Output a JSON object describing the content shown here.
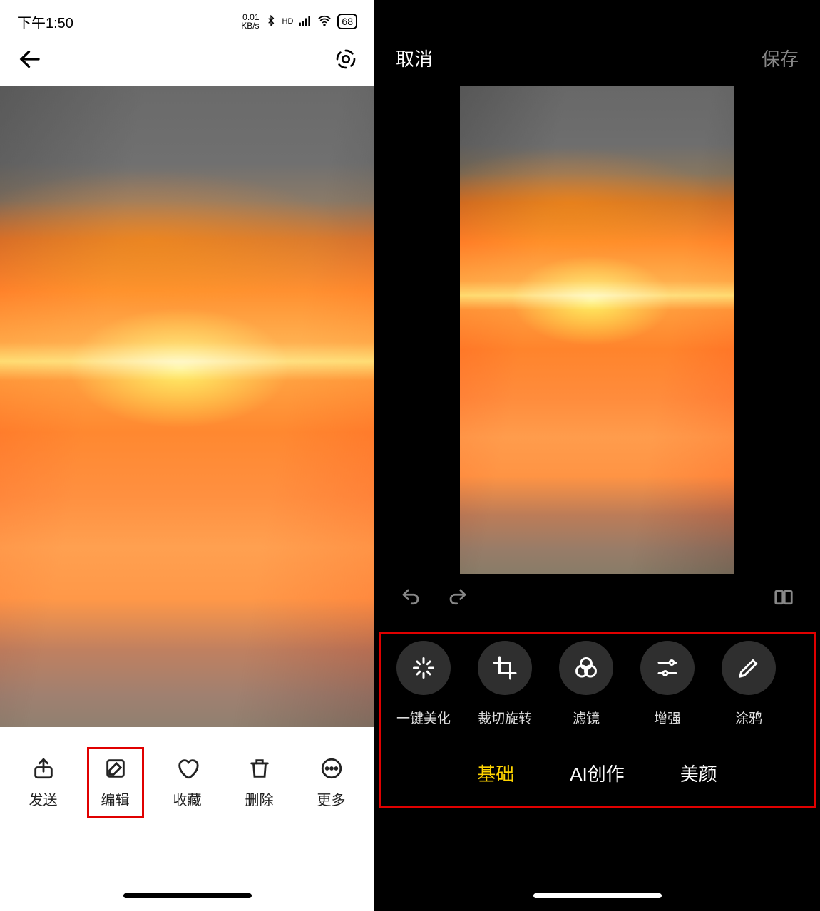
{
  "status": {
    "time": "下午1:50",
    "kbs": "0.01\nKB/s",
    "hd": "HD",
    "battery": "68"
  },
  "left": {
    "bottom": [
      {
        "label": "发送"
      },
      {
        "label": "编辑"
      },
      {
        "label": "收藏"
      },
      {
        "label": "删除"
      },
      {
        "label": "更多"
      }
    ]
  },
  "right": {
    "cancel": "取消",
    "save": "保存",
    "tools": [
      {
        "label": "一键美化"
      },
      {
        "label": "裁切旋转"
      },
      {
        "label": "滤镜"
      },
      {
        "label": "增强"
      },
      {
        "label": "涂鸦"
      }
    ],
    "categories": [
      {
        "label": "基础",
        "active": true
      },
      {
        "label": "AI创作",
        "active": false
      },
      {
        "label": "美颜",
        "active": false
      }
    ]
  }
}
